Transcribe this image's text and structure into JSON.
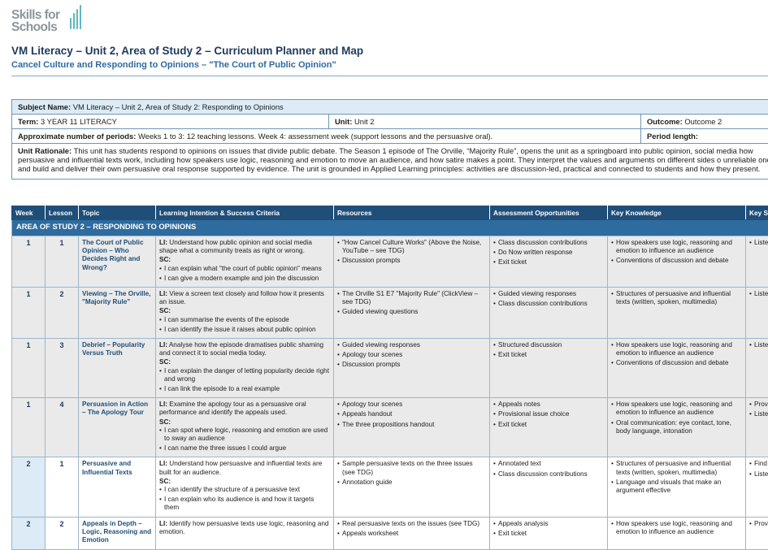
{
  "logo": {
    "line1": "Skills for",
    "line2": "Schools"
  },
  "title": "VM Literacy – Unit 2, Area of Study 2 – Curriculum Planner and Map",
  "subtitle": "Cancel Culture and Responding to Opinions – \"The Court of Public Opinion\"",
  "info": {
    "subject_label": "Subject Name:",
    "subject_value": "VM Literacy – Unit 2, Area of Study 2: Responding to Opinions",
    "term_label": "Term:",
    "term_value": "3  YEAR 11 LITERACY",
    "unit_label": "Unit:",
    "unit_value": "Unit 2",
    "outcome_label": "Outcome:",
    "outcome_value": "Outcome 2",
    "periods_label": "Approximate number of periods:",
    "periods_value": "Weeks 1 to 3: 12 teaching lessons. Week 4: assessment week (support lessons and the persuasive oral).",
    "period_length_label": "Period length:",
    "rationale_label": "Unit Rationale:",
    "rationale_text": "This unit has students respond to opinions on issues that divide public debate. The Season 1 episode of The Orville, “Majority Rule”, opens the unit as a springboard into public opinion, social media how persuasive and influential texts work, including how speakers use logic, reasoning and emotion to move an audience, and how satire makes a point. They interpret the values and arguments on different sides o unreliable ones, and build and deliver their own persuasive oral response supported by evidence. The unit is grounded in Applied Learning principles: activities are discussion-led, practical and connected to students and how they present."
  },
  "table": {
    "headers": [
      "Week",
      "Lesson",
      "Topic",
      "Learning Intention & Success Criteria",
      "Resources",
      "Assessment Opportunities",
      "Key Knowledge",
      "Key Skills"
    ],
    "section": "AREA OF STUDY 2 – RESPONDING TO OPINIONS",
    "li_label": "LI:",
    "sc_label": "SC:",
    "rows": [
      {
        "week": "1",
        "lesson": "1",
        "topic": "The Court of Public Opinion – Who Decides Right and Wrong?",
        "li": "Understand how public opinion and social media shape what a community treats as right or wrong.",
        "sc": [
          "I can explain what \"the court of public opinion\" means",
          "I can give a modern example and join the discussion"
        ],
        "resources": [
          "\"How Cancel Culture Works\" (Above the Noise, YouTube – see TDG)",
          "Discussion prompts"
        ],
        "assessment": [
          "Class discussion contributions",
          "Do Now written response",
          "Exit ticket"
        ],
        "knowledge": [
          "How speakers use logic, reasoning and emotion to influence an audience",
          "Conventions of discussion and debate"
        ],
        "skills": [
          "Liste"
        ]
      },
      {
        "week": "1",
        "lesson": "2",
        "topic": "Viewing – The Orville, \"Majority Rule\"",
        "li": "View a screen text closely and follow how it presents an issue.",
        "sc": [
          "I can summarise the events of the episode",
          "I can identify the issue it raises about public opinion"
        ],
        "resources": [
          "The Orville S1 E7 \"Majority Rule\" (ClickView – see TDG)",
          "Guided viewing questions"
        ],
        "assessment": [
          "Guided viewing responses",
          "Class discussion contributions"
        ],
        "knowledge": [
          "Structures of persuasive and influential texts (written, spoken, multimedia)"
        ],
        "skills": [
          "Liste"
        ]
      },
      {
        "week": "1",
        "lesson": "3",
        "topic": "Debrief – Popularity Versus Truth",
        "li": "Analyse how the episode dramatises public shaming and connect it to social media today.",
        "sc": [
          "I can explain the danger of letting popularity decide right and wrong",
          "I can link the episode to a real example"
        ],
        "resources": [
          "Guided viewing responses",
          "Apology tour scenes",
          "Discussion prompts"
        ],
        "assessment": [
          "Structured discussion",
          "Exit ticket"
        ],
        "knowledge": [
          "How speakers use logic, reasoning and emotion to influence an audience",
          "Conventions of discussion and debate"
        ],
        "skills": [
          "Liste"
        ]
      },
      {
        "week": "1",
        "lesson": "4",
        "topic": "Persuasion in Action – The Apology Tour",
        "li": "Examine the apology tour as a persuasive oral performance and identify the appeals used.",
        "sc": [
          "I can spot where logic, reasoning and emotion are used to sway an audience",
          "I can name the three issues I could argue"
        ],
        "resources": [
          "Apology tour scenes",
          "Appeals handout",
          "The three propositions handout"
        ],
        "assessment": [
          "Appeals notes",
          "Provisional issue choice",
          "Exit ticket"
        ],
        "knowledge": [
          "How speakers use logic, reasoning and emotion to influence an audience",
          "Oral communication: eye contact, tone, body language, intonation"
        ],
        "skills": [
          "Prov of vi",
          "Liste"
        ]
      },
      {
        "week": "2",
        "lesson": "1",
        "topic": "Persuasive and Influential Texts",
        "li": "Understand how persuasive and influential texts are built for an audience.",
        "sc": [
          "I can identify the structure of a persuasive text",
          "I can explain who its audience is and how it targets them"
        ],
        "resources": [
          "Sample persuasive texts on the three issues (see TDG)",
          "Annotation guide"
        ],
        "assessment": [
          "Annotated text",
          "Class discussion contributions"
        ],
        "knowledge": [
          "Structures of persuasive and influential texts (written, spoken, multimedia)",
          "Language and visuals that make an argument effective"
        ],
        "skills": [
          "Find",
          "Liste"
        ]
      },
      {
        "week": "2",
        "lesson": "2",
        "topic": "Appeals in Depth – Logic, Reasoning and Emotion",
        "li": "Identify how persuasive texts use logic, reasoning and emotion.",
        "sc": [],
        "resources": [
          "Real persuasive texts on the issues (see TDG)",
          "Appeals worksheet"
        ],
        "assessment": [
          "Appeals analysis",
          "Exit ticket"
        ],
        "knowledge": [
          "How speakers use logic, reasoning and emotion to influence an audience"
        ],
        "skills": [
          "Prov"
        ]
      }
    ]
  }
}
